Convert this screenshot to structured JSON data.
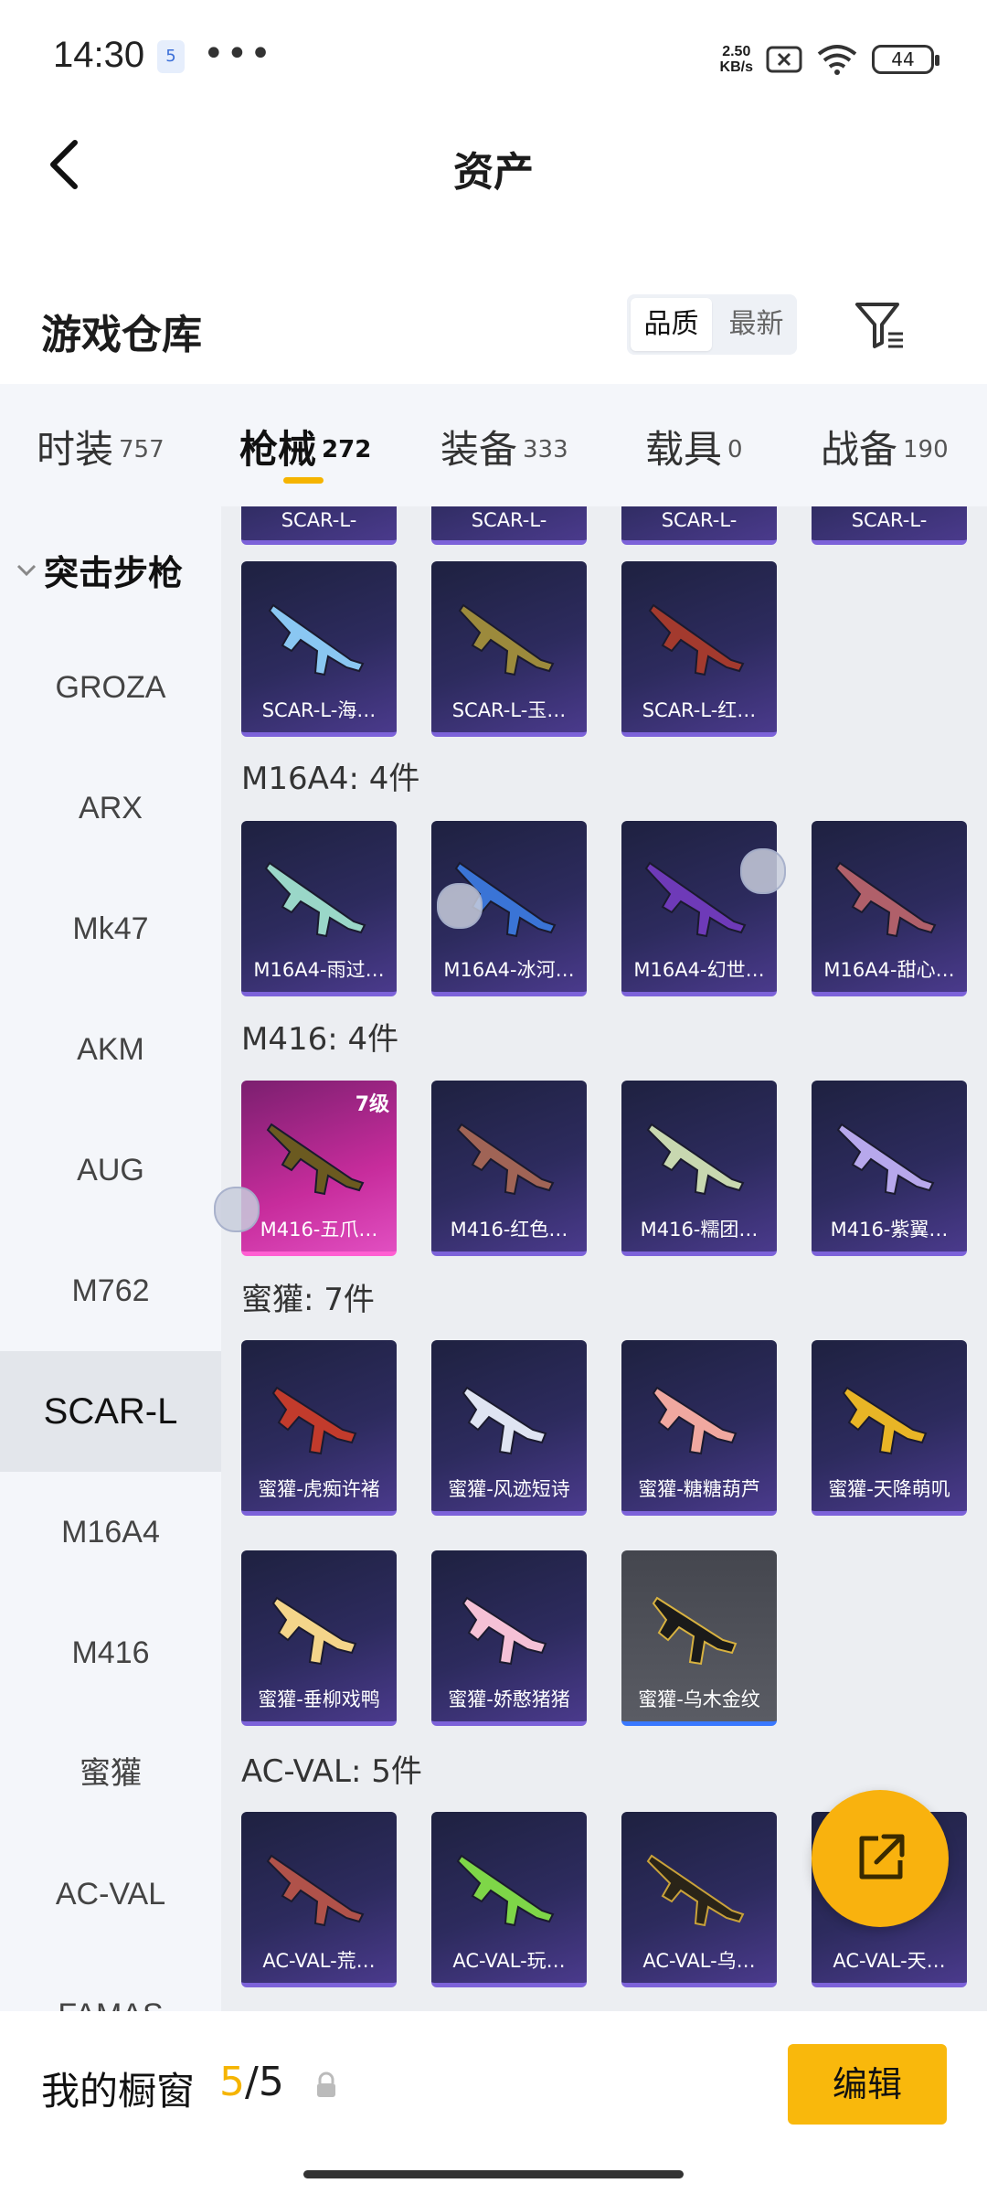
{
  "status": {
    "time": "14:30",
    "app_badge": "5",
    "more": "•••",
    "speed_top": "2.50",
    "speed_bottom": "KB/s",
    "battery": "44"
  },
  "header": {
    "title": "资产"
  },
  "warehouse": {
    "title": "游戏仓库",
    "sort_options": [
      "品质",
      "最新"
    ]
  },
  "tabs": [
    {
      "label": "时装",
      "count": "757"
    },
    {
      "label": "枪械",
      "count": "272"
    },
    {
      "label": "装备",
      "count": "333"
    },
    {
      "label": "载具",
      "count": "0"
    },
    {
      "label": "战备",
      "count": "190"
    }
  ],
  "sidebar": {
    "category": "突击步枪",
    "items": [
      "GROZA",
      "ARX",
      "Mk47",
      "AKM",
      "AUG",
      "M762",
      "SCAR-L",
      "M16A4",
      "M416",
      "蜜獾",
      "AC-VAL",
      "FAMAS"
    ],
    "active": "SCAR-L"
  },
  "content": {
    "top_partial": [
      "SCAR-L-",
      "SCAR-L-",
      "SCAR-L-",
      "SCAR-L-"
    ],
    "scar_cards": [
      "SCAR-L-海…",
      "SCAR-L-玉…",
      "SCAR-L-红…"
    ],
    "sections": [
      {
        "title": "M16A4: 4件",
        "cards": [
          "M16A4-雨过…",
          "M16A4-冰河…",
          "M16A4-幻世…",
          "M16A4-甜心…"
        ]
      },
      {
        "title": "M416: 4件",
        "cards": [
          "M416-五爪…",
          "M416-红色…",
          "M416-糯团…",
          "M416-紫翼…"
        ],
        "level_badge": "7级"
      },
      {
        "title": "蜜獾: 7件",
        "cards": [
          "蜜獾-虎痴许褚",
          "蜜獾-风迹短诗",
          "蜜獾-糖糖葫芦",
          "蜜獾-天降萌叽",
          "蜜獾-垂柳戏鸭",
          "蜜獾-娇憨猪猪",
          "蜜獾-乌木金纹"
        ]
      },
      {
        "title": "AC-VAL: 5件",
        "cards": [
          "AC-VAL-荒…",
          "AC-VAL-玩…",
          "AC-VAL-乌…",
          "AC-VAL-天…"
        ]
      }
    ]
  },
  "bottom": {
    "label": "我的橱窗",
    "current": "5",
    "total": "/5",
    "edit": "编辑"
  },
  "colors": {
    "accent": "#f5b400",
    "card_purple": "#2d2b5e",
    "card_pink": "#c72c9c",
    "card_gray": "#5a5c64"
  },
  "icons": {
    "back": "chevron-left-icon",
    "filter": "filter-icon",
    "share": "external-link-icon",
    "lock": "lock-icon"
  }
}
